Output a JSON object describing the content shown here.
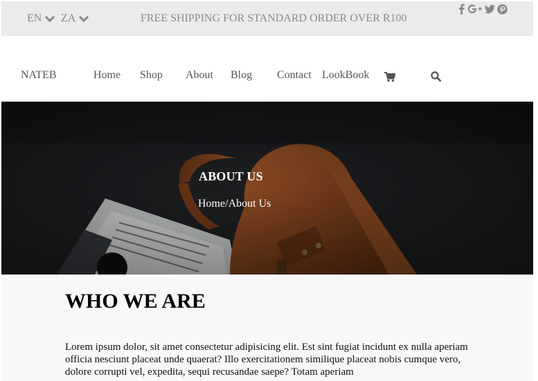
{
  "topbar": {
    "lang": "EN",
    "region": "ZA",
    "promo": "FREE SHIPPING FOR STANDARD ORDER OVER R100",
    "social_icons": [
      "facebook-icon",
      "google-plus-icon",
      "twitter-icon",
      "pinterest-icon"
    ]
  },
  "nav": {
    "brand": "NATEB",
    "items": [
      {
        "label": "Home"
      },
      {
        "label": "Shop"
      },
      {
        "label": "About"
      },
      {
        "label": "Blog"
      },
      {
        "label": "Contact"
      },
      {
        "label": "LookBook"
      }
    ],
    "icons": [
      "cart-icon",
      "search-icon"
    ]
  },
  "hero": {
    "title": "ABOUT US",
    "breadcrumb": {
      "home": "Home",
      "separator": "/",
      "current": "About Us"
    }
  },
  "content": {
    "heading": "WHO WE ARE",
    "text": "Lorem ipsum dolor, sit amet consectetur adipisicing elit. Est sint fugiat incidunt ex nulla aperiam officia nesciunt placeat unde quaerat? Illo exercitationem similique placeat nobis cumque vero, dolore corrupti vel, expedita, sequi recusandae saepe? Totam aperiam"
  },
  "colors": {
    "topbar_bg": "#ebebeb",
    "muted_text": "#888888",
    "nav_text": "#555555",
    "hero_text": "#ffffff",
    "content_bg": "#f8f8f8",
    "leather": "#8a4a22"
  }
}
